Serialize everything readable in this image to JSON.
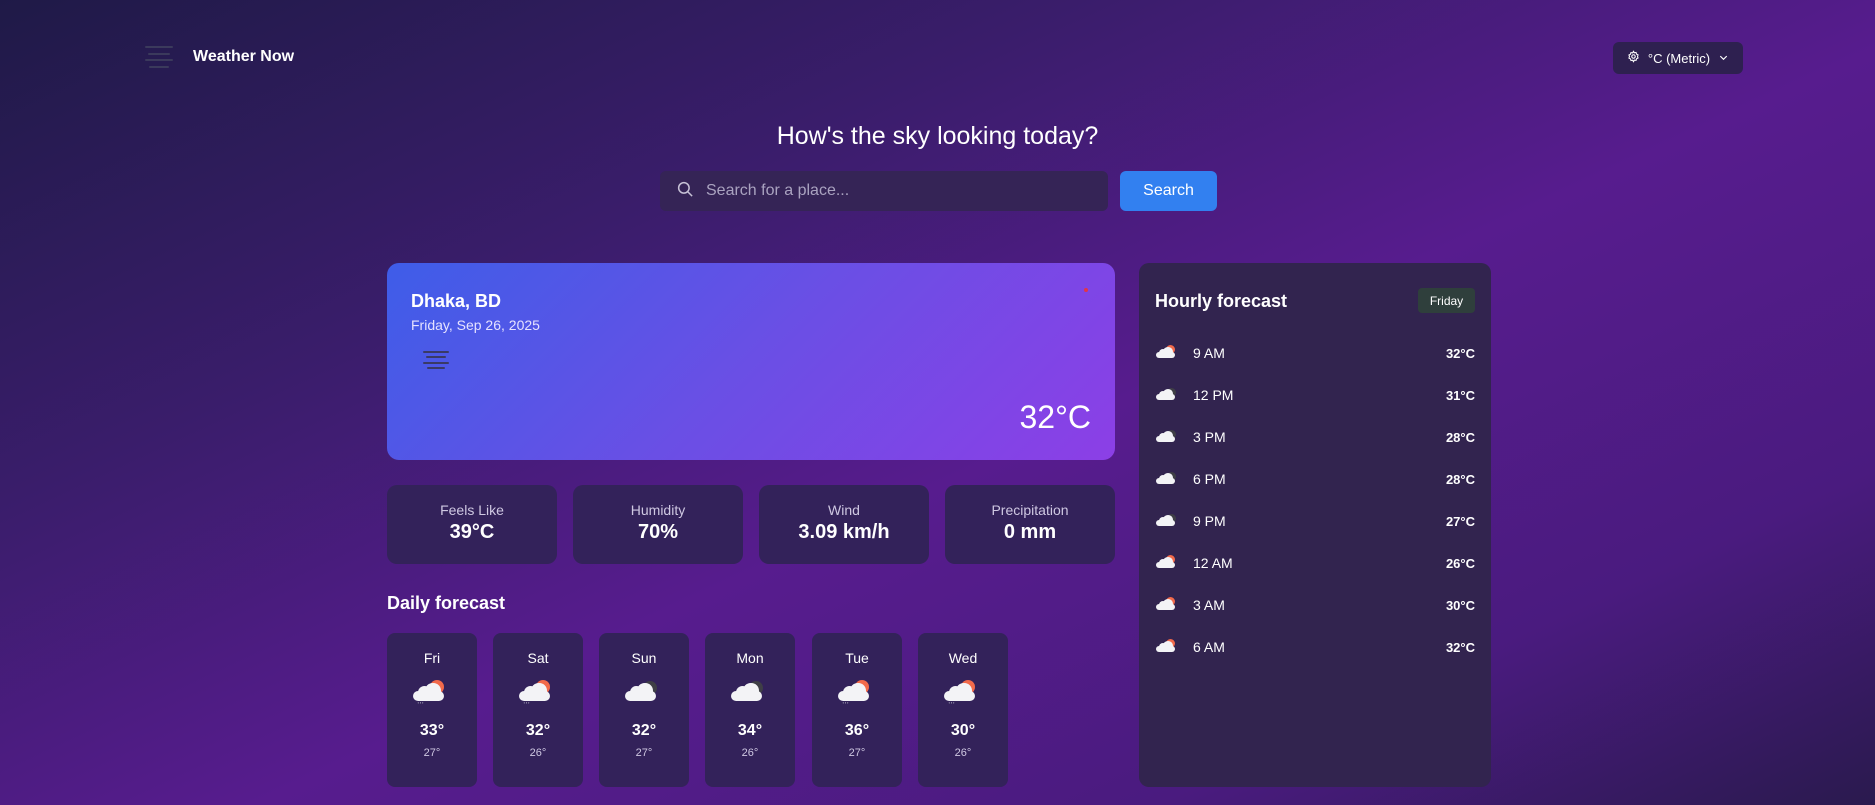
{
  "app": {
    "title": "Weather Now",
    "logo_icon": "fog-icon"
  },
  "header": {
    "units_label": "°C (Metric)",
    "units_icon": "gear-icon"
  },
  "hero": {
    "title": "How's the sky looking today?"
  },
  "search": {
    "placeholder": "Search for a place...",
    "value": "",
    "button_label": "Search"
  },
  "current": {
    "city": "Dhaka, BD",
    "date": "Friday, Sep 26, 2025",
    "icon": "fog-icon",
    "temperature": "32°C"
  },
  "stats": [
    {
      "label": "Feels Like",
      "value": "39°C"
    },
    {
      "label": "Humidity",
      "value": "70%"
    },
    {
      "label": "Wind",
      "value": "3.09 km/h"
    },
    {
      "label": "Precipitation",
      "value": "0 mm"
    }
  ],
  "daily": {
    "title": "Daily forecast",
    "days": [
      {
        "name": "Fri",
        "high": "33°",
        "low": "27°",
        "icon": "rain-sun-icon"
      },
      {
        "name": "Sat",
        "high": "32°",
        "low": "26°",
        "icon": "rain-sun-icon"
      },
      {
        "name": "Sun",
        "high": "32°",
        "low": "27°",
        "icon": "cloud-moon-icon"
      },
      {
        "name": "Mon",
        "high": "34°",
        "low": "26°",
        "icon": "cloud-moon-icon"
      },
      {
        "name": "Tue",
        "high": "36°",
        "low": "27°",
        "icon": "rain-sun-icon"
      },
      {
        "name": "Wed",
        "high": "30°",
        "low": "26°",
        "icon": "rain-sun-icon"
      }
    ]
  },
  "hourly": {
    "title": "Hourly forecast",
    "day_selector": "Friday",
    "hours": [
      {
        "time": "9 AM",
        "temp": "32°C",
        "icon": "cloud-sun-icon"
      },
      {
        "time": "12 PM",
        "temp": "31°C",
        "icon": "cloud-moon-icon"
      },
      {
        "time": "3 PM",
        "temp": "28°C",
        "icon": "cloud-moon-icon"
      },
      {
        "time": "6 PM",
        "temp": "28°C",
        "icon": "cloud-moon-icon"
      },
      {
        "time": "9 PM",
        "temp": "27°C",
        "icon": "cloud-moon-icon"
      },
      {
        "time": "12 AM",
        "temp": "26°C",
        "icon": "cloud-sun-icon"
      },
      {
        "time": "3 AM",
        "temp": "30°C",
        "icon": "cloud-sun-icon"
      },
      {
        "time": "6 AM",
        "temp": "32°C",
        "icon": "cloud-sun-icon"
      }
    ]
  },
  "colors": {
    "accent": "#3280f0",
    "card_gradient_start": "#3e5de8",
    "card_gradient_end": "#8c3fe6",
    "panel": "#33225a",
    "sun": "#f26a4b"
  }
}
